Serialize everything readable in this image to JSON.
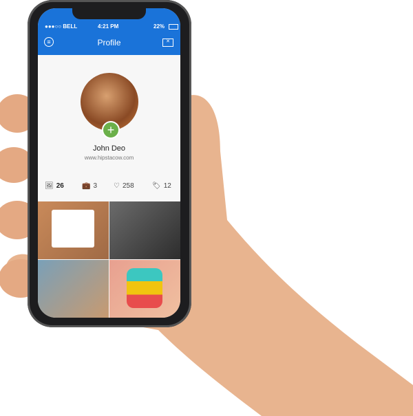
{
  "status_bar": {
    "carrier": "●●●○○ BELL",
    "time": "4:21 PM",
    "battery": "22%"
  },
  "header": {
    "title": "Profile",
    "menu_icon": "menu-circle-icon",
    "mail_icon": "mail-icon"
  },
  "profile": {
    "name": "John Deo",
    "website": "www.hipstacow.com"
  },
  "stats": [
    {
      "icon": "image-icon",
      "value": "26"
    },
    {
      "icon": "briefcase-icon",
      "value": "3"
    },
    {
      "icon": "heart-icon",
      "value": "258"
    },
    {
      "icon": "tag-icon",
      "value": "12"
    }
  ],
  "colors": {
    "brand": "#1a73d9",
    "accent": "#6bb04a"
  }
}
